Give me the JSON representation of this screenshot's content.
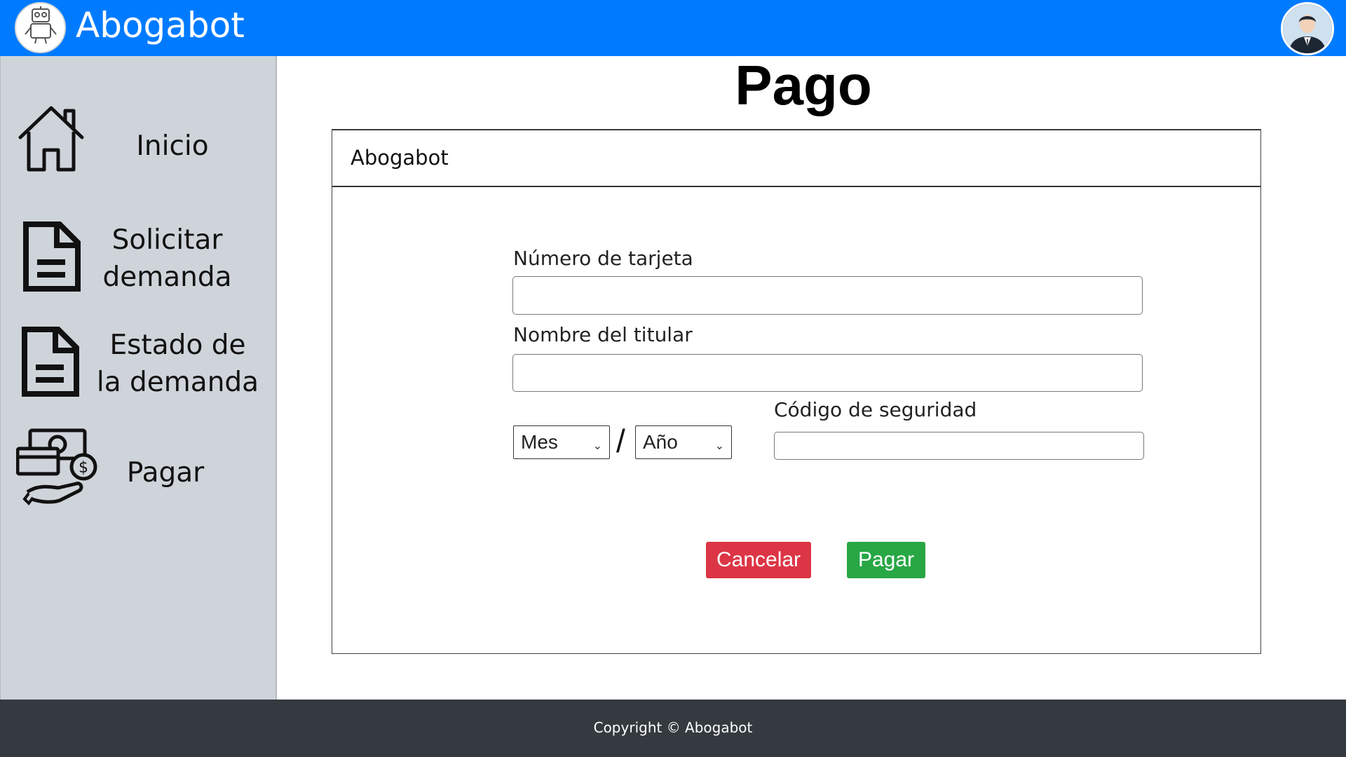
{
  "header": {
    "app_name": "Abogabot",
    "logo_caption": "Abogabot",
    "logo_icon": "robot-icon",
    "avatar_icon": "user-avatar-icon"
  },
  "sidebar": {
    "items": [
      {
        "label": "Inicio",
        "icon": "house-icon"
      },
      {
        "label": "Solicitar demanda",
        "icon": "document-icon"
      },
      {
        "label": "Estado de la demanda",
        "icon": "document-icon"
      },
      {
        "label": "Pagar",
        "icon": "payment-icon"
      }
    ]
  },
  "main": {
    "title": "Pago",
    "card_title": "Abogabot",
    "form": {
      "card_number_label": "Número de tarjeta",
      "card_number_value": "",
      "holder_label": "Nombre del titular",
      "holder_value": "",
      "month_value": "Mes",
      "year_value": "Año",
      "date_separator": "/",
      "cvv_label": "Código de seguridad",
      "cvv_value": ""
    },
    "buttons": {
      "cancel": "Cancelar",
      "pay": "Pagar"
    }
  },
  "footer": {
    "copyright": "Copyright © Abogabot"
  },
  "colors": {
    "header": "#007bff",
    "sidebar": "#ced4da",
    "footer": "#343a40",
    "cancel": "#dc3545",
    "pay": "#28a745"
  }
}
